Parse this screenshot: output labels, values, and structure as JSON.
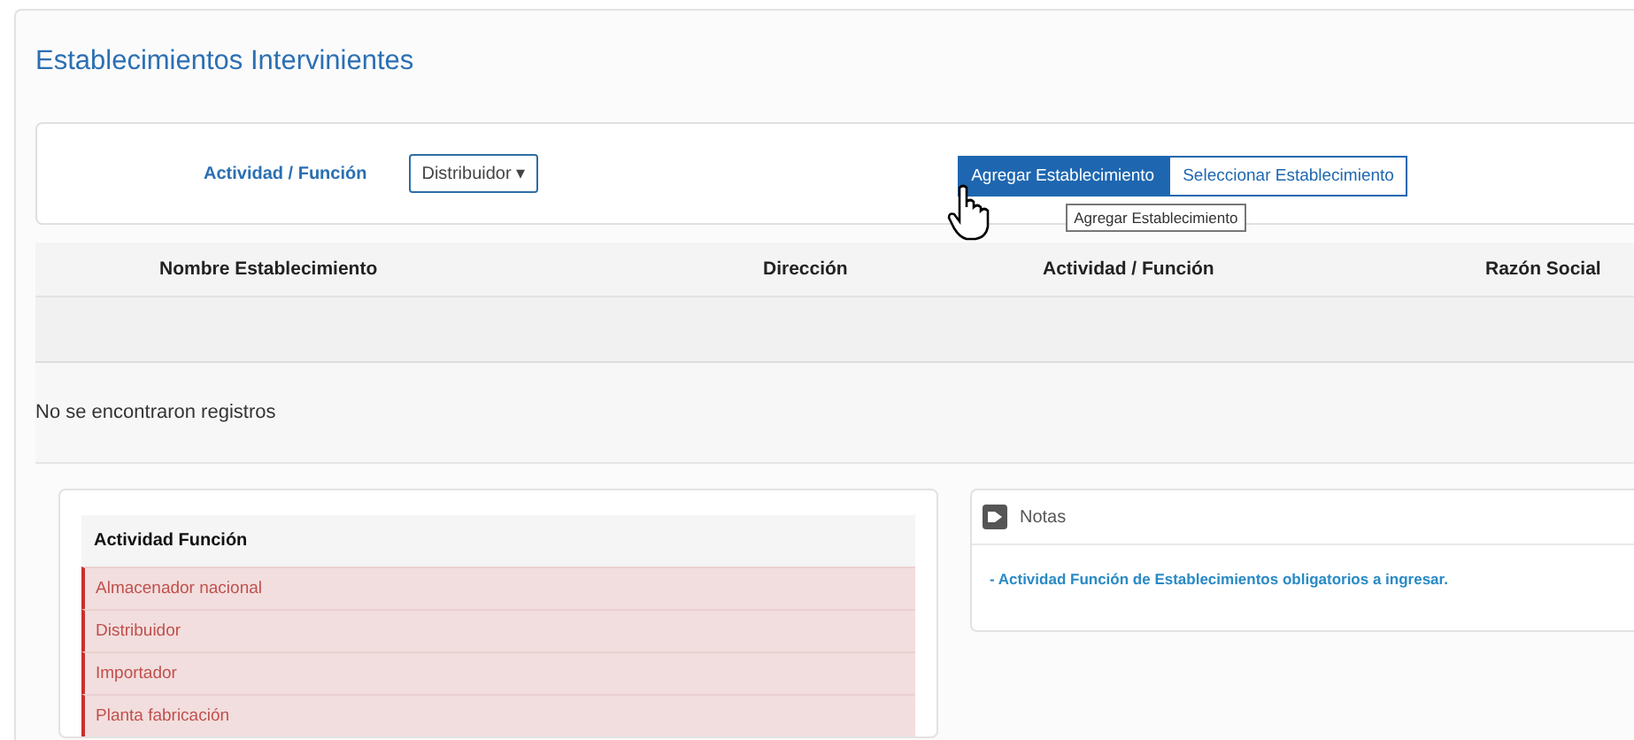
{
  "title": "Establecimientos Intervinientes",
  "filter": {
    "label": "Actividad / Función",
    "value": "Distribuidor",
    "caret": "▾"
  },
  "actions": [
    {
      "label": "Agregar Establecimiento",
      "selected": true
    },
    {
      "label": "Seleccionar Establecimiento",
      "selected": false
    }
  ],
  "tooltip": "Agregar Establecimiento",
  "table": {
    "columns": [
      "Nombre Establecimiento",
      "Dirección",
      "Actividad / Función",
      "Razón Social"
    ],
    "empty_message": "No se encontraron registros"
  },
  "required": {
    "header": "Actividad Función",
    "rows": [
      "Almacenador nacional",
      "Distribuidor",
      "Importador",
      "Planta fabricación"
    ]
  },
  "notes": {
    "title": "Notas",
    "text": "- Actividad Función de Establecimientos obligatorios a ingresar."
  }
}
